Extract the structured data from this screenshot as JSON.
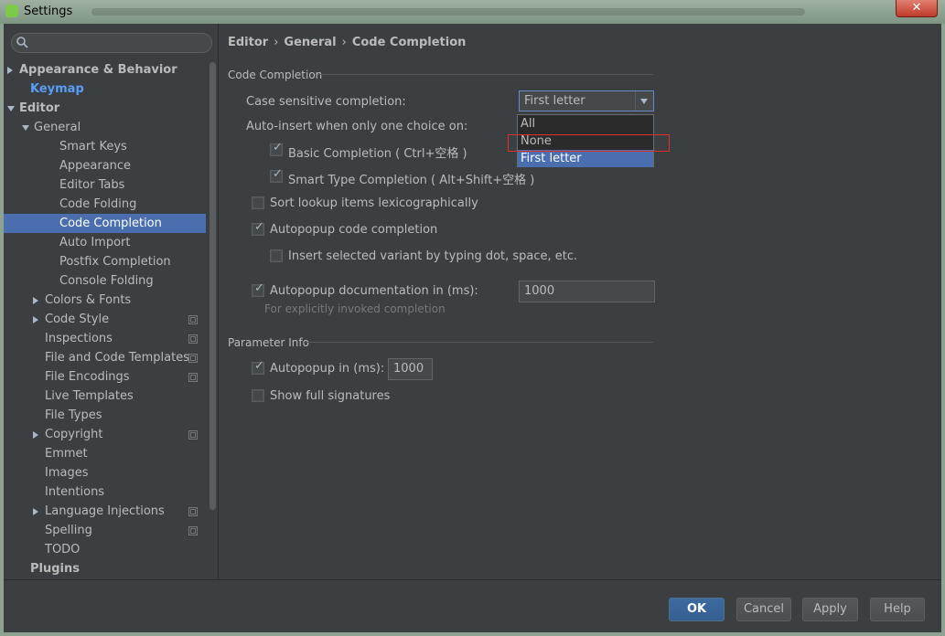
{
  "window": {
    "title": "Settings",
    "close_label": "✕"
  },
  "search": {
    "placeholder": ""
  },
  "tree": [
    {
      "label": "Appearance & Behavior",
      "arrow": "right"
    },
    {
      "label": "Keymap"
    },
    {
      "label": "Editor",
      "arrow": "down"
    },
    {
      "label": "General",
      "arrow": "down"
    },
    {
      "label": "Smart Keys"
    },
    {
      "label": "Appearance"
    },
    {
      "label": "Editor Tabs"
    },
    {
      "label": "Code Folding"
    },
    {
      "label": "Code Completion",
      "selected": true
    },
    {
      "label": "Auto Import"
    },
    {
      "label": "Postfix Completion"
    },
    {
      "label": "Console Folding"
    },
    {
      "label": "Colors & Fonts",
      "arrow": "right"
    },
    {
      "label": "Code Style",
      "arrow": "right",
      "copy_icon": true
    },
    {
      "label": "Inspections",
      "copy_icon": true
    },
    {
      "label": "File and Code Templates",
      "copy_icon": true
    },
    {
      "label": "File Encodings",
      "copy_icon": true
    },
    {
      "label": "Live Templates"
    },
    {
      "label": "File Types"
    },
    {
      "label": "Copyright",
      "arrow": "right",
      "copy_icon": true
    },
    {
      "label": "Emmet"
    },
    {
      "label": "Images"
    },
    {
      "label": "Intentions"
    },
    {
      "label": "Language Injections",
      "arrow": "right",
      "copy_icon": true
    },
    {
      "label": "Spelling",
      "copy_icon": true
    },
    {
      "label": "TODO"
    },
    {
      "label": "Plugins"
    }
  ],
  "breadcrumb": {
    "part1": "Editor",
    "part2": "General",
    "part3": "Code Completion",
    "sep": "›"
  },
  "code_completion": {
    "section_title": "Code Completion",
    "case_sensitive_label": "Case sensitive completion:",
    "case_sensitive_value": "First letter",
    "auto_insert_label": "Auto-insert when only one choice on:",
    "basic_completion": {
      "label": "Basic Completion ( Ctrl+空格 )",
      "checked": true
    },
    "smart_type_completion": {
      "label": "Smart Type Completion ( Alt+Shift+空格 )",
      "checked": true
    },
    "sort_lookup": {
      "label": "Sort lookup items lexicographically",
      "checked": false
    },
    "autopopup_completion": {
      "label": "Autopopup code completion",
      "checked": true
    },
    "insert_selected_variant": {
      "label": "Insert selected variant by typing dot, space, etc.",
      "checked": false
    },
    "autopopup_documentation": {
      "label": "Autopopup documentation in (ms):",
      "checked": true,
      "value": "1000"
    },
    "documentation_hint": "For explicitly invoked completion"
  },
  "dropdown": {
    "options": [
      "All",
      "None",
      "First letter"
    ],
    "selected": "First letter"
  },
  "parameter_info": {
    "section_title": "Parameter Info",
    "autopopup": {
      "label": "Autopopup in (ms):",
      "checked": true,
      "value": "1000"
    },
    "show_full_signatures": {
      "label": "Show full signatures",
      "checked": false
    }
  },
  "buttons": {
    "ok": "OK",
    "cancel": "Cancel",
    "apply": "Apply",
    "help": "Help"
  },
  "colors": {
    "background": "#3c3f41",
    "selection": "#4b6eaf",
    "highlight_box": "#e0302a",
    "keymap_label": "#589df6"
  }
}
